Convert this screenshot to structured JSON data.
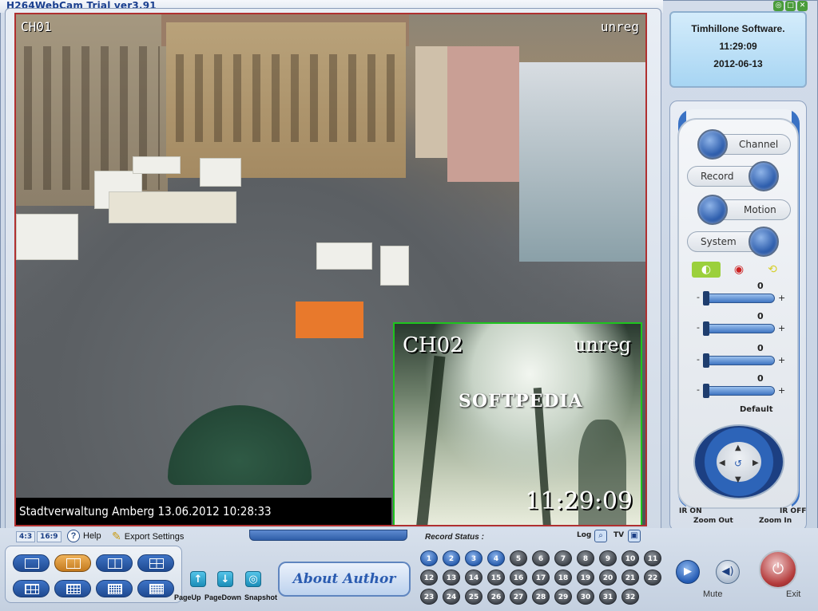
{
  "window": {
    "title": "H264WebCam Trial ver3.91",
    "buttons": [
      "◎",
      "□",
      "✕"
    ]
  },
  "main_video": {
    "channel": "CH01",
    "watermark": "unreg",
    "caption": "Stadtverwaltung Amberg  13.06.2012 10:28:33"
  },
  "sub_video": {
    "channel": "CH02",
    "watermark": "unreg",
    "overlay_text": "SOFTPEDIA",
    "timestamp": "11:29:09"
  },
  "info": {
    "company": "Timhillone Software.",
    "time": "11:29:09",
    "date": "2012-06-13"
  },
  "controls": {
    "channel_label": "Channel",
    "record_label": "Record",
    "motion_label": "Motion",
    "system_label": "System",
    "sliders": [
      {
        "value": "0",
        "minus": "-",
        "plus": "+"
      },
      {
        "value": "0",
        "minus": "-",
        "plus": "+"
      },
      {
        "value": "0",
        "minus": "-",
        "plus": "+"
      },
      {
        "value": "0",
        "minus": "-",
        "plus": "+"
      }
    ],
    "default_label": "Default",
    "ptz": {
      "ir_on": "IR ON",
      "ir_off": "IR OFF",
      "zoom_out": "Zoom Out",
      "zoom_in": "Zoom In"
    }
  },
  "bottom": {
    "ratio_43": "4:3",
    "ratio_169": "16:9",
    "help_label": "Help",
    "export_label": "Export Settings",
    "record_status_label": "Record Status :",
    "log_label": "Log",
    "tv_label": "TV",
    "pageup_label": "PageUp",
    "pagedown_label": "PageDown",
    "snapshot_label": "Snapshot",
    "about_label": "About  Author",
    "mute_label": "Mute",
    "exit_label": "Exit",
    "channel_numbers": [
      "1",
      "2",
      "3",
      "4",
      "5",
      "6",
      "7",
      "8",
      "9",
      "10",
      "11",
      "12",
      "13",
      "14",
      "15",
      "16",
      "17",
      "18",
      "19",
      "20",
      "21",
      "22",
      "23",
      "24",
      "25",
      "26",
      "27",
      "28",
      "29",
      "30",
      "31",
      "32"
    ],
    "active_channels": [
      "1",
      "2",
      "3",
      "4"
    ]
  }
}
